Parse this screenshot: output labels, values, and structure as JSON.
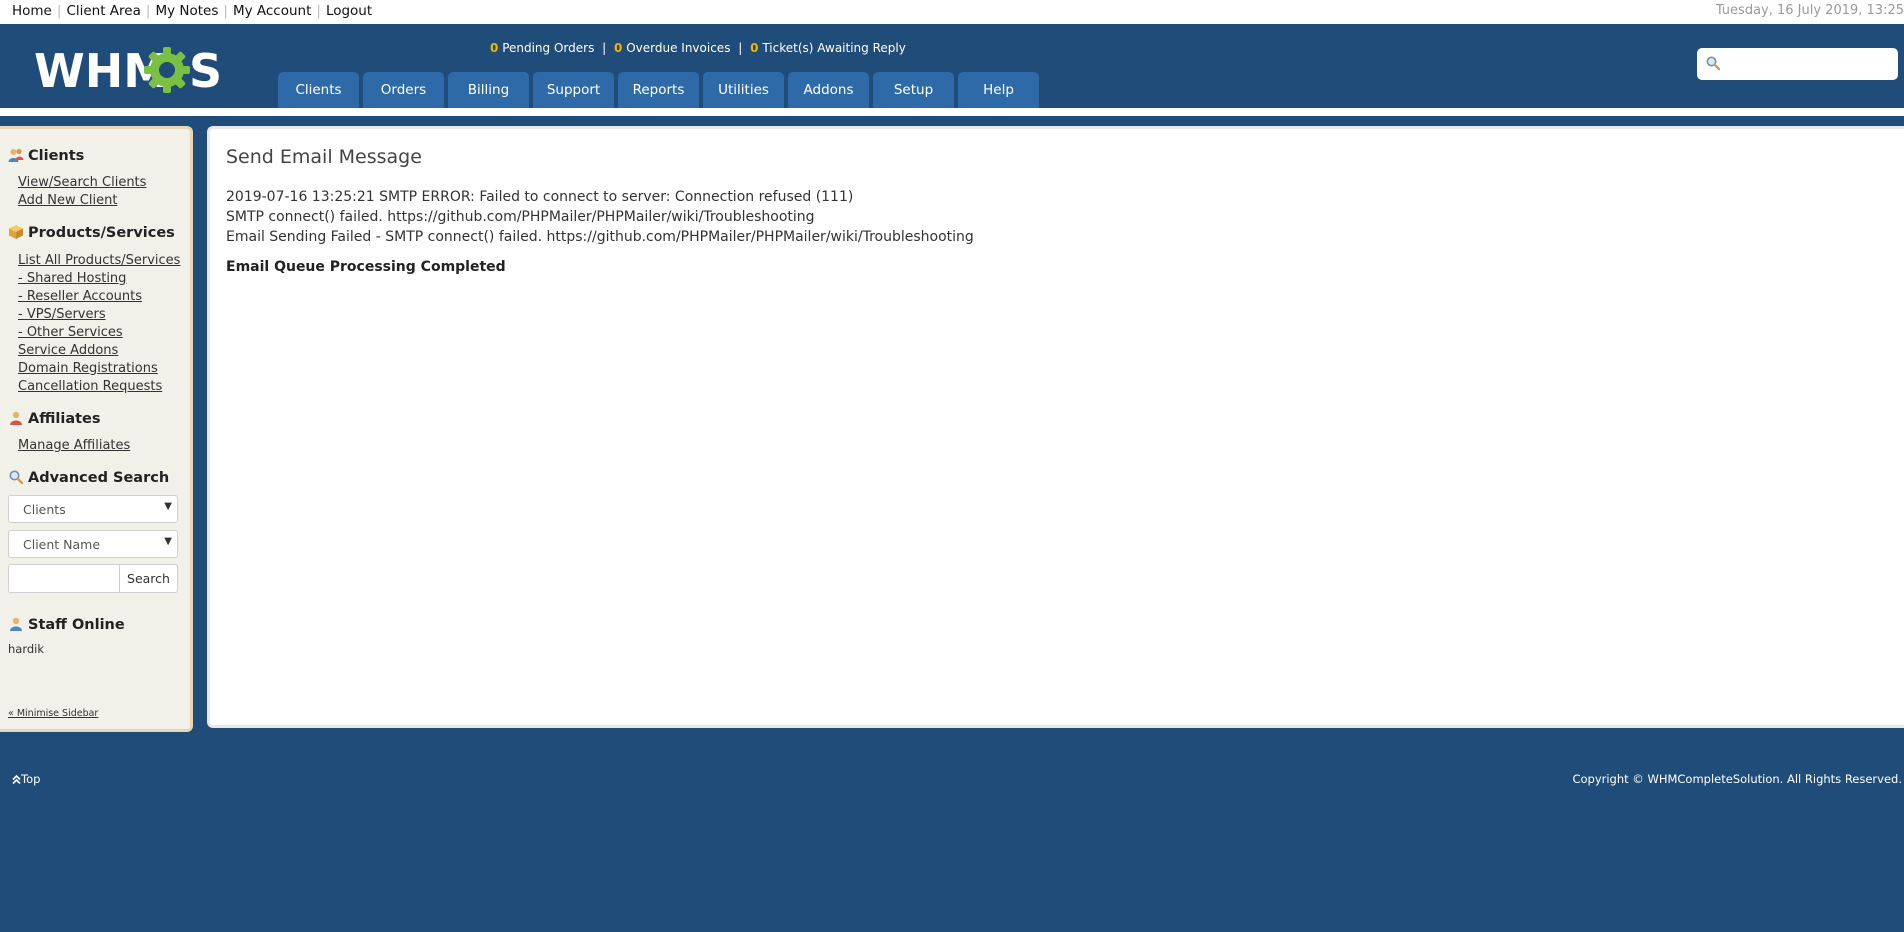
{
  "top": {
    "links": [
      "Home",
      "Client Area",
      "My Notes",
      "My Account",
      "Logout"
    ],
    "date": "Tuesday, 16 July 2019, 13:25"
  },
  "header": {
    "logo_text": "WHMCS",
    "stats": {
      "pending_orders_count": "0",
      "pending_orders_label": "Pending Orders",
      "overdue_invoices_count": "0",
      "overdue_invoices_label": "Overdue Invoices",
      "tickets_count": "0",
      "tickets_label": "Ticket(s) Awaiting Reply"
    },
    "search_placeholder": "",
    "nav": [
      "Clients",
      "Orders",
      "Billing",
      "Support",
      "Reports",
      "Utilities",
      "Addons",
      "Setup",
      "Help"
    ]
  },
  "sidebar": {
    "clients_heading": "Clients",
    "clients_links": [
      "View/Search Clients",
      "Add New Client"
    ],
    "products_heading": "Products/Services",
    "products_links": [
      "List All Products/Services",
      "- Shared Hosting",
      "- Reseller Accounts",
      "- VPS/Servers",
      "- Other Services",
      "Service Addons",
      "Domain Registrations",
      "Cancellation Requests"
    ],
    "affiliates_heading": "Affiliates",
    "affiliates_links": [
      "Manage Affiliates"
    ],
    "advanced_search_heading": "Advanced Search",
    "search_type": "Clients",
    "search_field": "Client Name",
    "search_button": "Search",
    "staff_heading": "Staff Online",
    "staff_name": "hardik",
    "minimise": "« Minimise Sidebar"
  },
  "content": {
    "title": "Send Email Message",
    "messages": [
      "2019-07-16 13:25:21 SMTP ERROR: Failed to connect to server: Connection refused (111)",
      "SMTP connect() failed. https://github.com/PHPMailer/PHPMailer/wiki/Troubleshooting",
      "Email Sending Failed - SMTP connect() failed. https://github.com/PHPMailer/PHPMailer/wiki/Troubleshooting"
    ],
    "completed": "Email Queue Processing Completed"
  },
  "footer": {
    "top_link": "Top",
    "copyright": "Copyright © WHMCompleteSolution. All Rights Reserved."
  },
  "colors": {
    "header_bg": "#204c7a",
    "nav_tab": "#2f6aa8",
    "stat_count": "#f5b400",
    "logo_gear": "#7ac143"
  }
}
